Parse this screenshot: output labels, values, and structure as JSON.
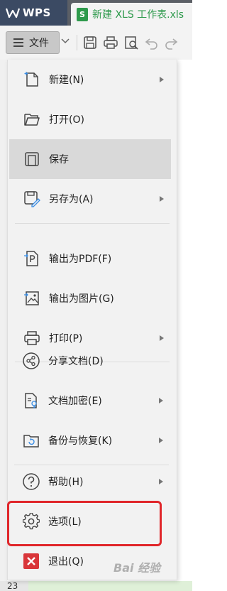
{
  "topbar": {
    "app_name": "WPS",
    "file_tab": "新建 XLS 工作表.xls",
    "file_badge": "S"
  },
  "toolbar": {
    "file_menu_label": "文件"
  },
  "menu": {
    "items": [
      {
        "label": "新建(N)",
        "icon": "new-file-icon",
        "has_submenu": true
      },
      {
        "label": "打开(O)",
        "icon": "folder-open-icon",
        "has_submenu": false
      },
      {
        "label": "保存",
        "icon": "save-icon",
        "has_submenu": false,
        "highlighted": true
      },
      {
        "label": "另存为(A)",
        "icon": "save-as-icon",
        "has_submenu": true
      },
      {
        "label": "输出为PDF(F)",
        "icon": "export-pdf-icon",
        "has_submenu": false
      },
      {
        "label": "输出为图片(G)",
        "icon": "export-image-icon",
        "has_submenu": false
      },
      {
        "label": "打印(P)",
        "icon": "print-icon",
        "has_submenu": true
      },
      {
        "label": "分享文档(D)",
        "icon": "share-icon",
        "has_submenu": false
      },
      {
        "label": "文档加密(E)",
        "icon": "encrypt-document-icon",
        "has_submenu": true
      },
      {
        "label": "备份与恢复(K)",
        "icon": "backup-restore-icon",
        "has_submenu": true
      },
      {
        "label": "帮助(H)",
        "icon": "help-icon",
        "has_submenu": true
      },
      {
        "label": "选项(L)",
        "icon": "gear-icon",
        "has_submenu": false,
        "annotated": true
      },
      {
        "label": "退出(Q)",
        "icon": "exit-icon",
        "has_submenu": false
      }
    ]
  },
  "sheet": {
    "row_number": "23"
  },
  "watermark": "Bai 经验",
  "colors": {
    "annotation_box": "#e0262a",
    "xls_green": "#2e9a4c",
    "exit_red": "#d9363a",
    "highlight": "#d9d9d9"
  }
}
